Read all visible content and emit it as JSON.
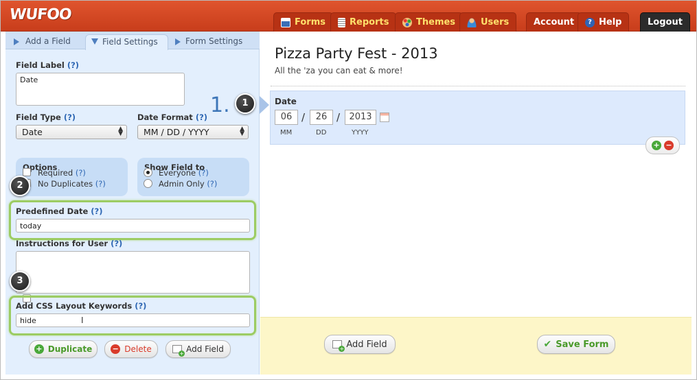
{
  "app": {
    "logo": "WUFOO"
  },
  "nav": {
    "forms": "Forms",
    "reports": "Reports",
    "themes": "Themes",
    "users": "Users",
    "account": "Account",
    "help": "Help",
    "logout": "Logout"
  },
  "tabs": {
    "add_field": "Add a Field",
    "field_settings": "Field Settings",
    "form_settings": "Form Settings"
  },
  "settings": {
    "step_number": "1.",
    "help_mark": "(?)",
    "field_label": {
      "label": "Field Label",
      "value": "Date"
    },
    "field_type": {
      "label": "Field Type",
      "value": "Date"
    },
    "date_format": {
      "label": "Date Format",
      "value": "MM / DD / YYYY"
    },
    "options": {
      "title": "Options",
      "required": "Required",
      "no_duplicates": "No Duplicates"
    },
    "show_field_to": {
      "title": "Show Field to",
      "everyone": "Everyone",
      "admin_only": "Admin Only",
      "selected": "Everyone"
    },
    "predefined_date": {
      "label": "Predefined Date",
      "value": "today"
    },
    "instructions": {
      "label": "Instructions for User",
      "value": ""
    },
    "css_keywords": {
      "label": "Add CSS Layout Keywords",
      "value": "hide"
    },
    "buttons": {
      "duplicate": "Duplicate",
      "delete": "Delete",
      "add_field": "Add Field"
    }
  },
  "callouts": {
    "one": "1",
    "two": "2",
    "three": "3"
  },
  "form": {
    "title": "Pizza Party Fest - 2013",
    "description": "All the 'za you can eat & more!",
    "field": {
      "label": "Date",
      "month": "06",
      "day": "26",
      "year": "2013",
      "separator": "/",
      "mm": "MM",
      "dd": "DD",
      "yyyy": "YYYY"
    },
    "footer": {
      "add_field": "Add Field",
      "save_form": "Save Form"
    }
  },
  "colors": {
    "header": "#d6492a",
    "panel": "#e3effd",
    "highlight": "#9ccc63",
    "footer": "#fdf6c8"
  }
}
